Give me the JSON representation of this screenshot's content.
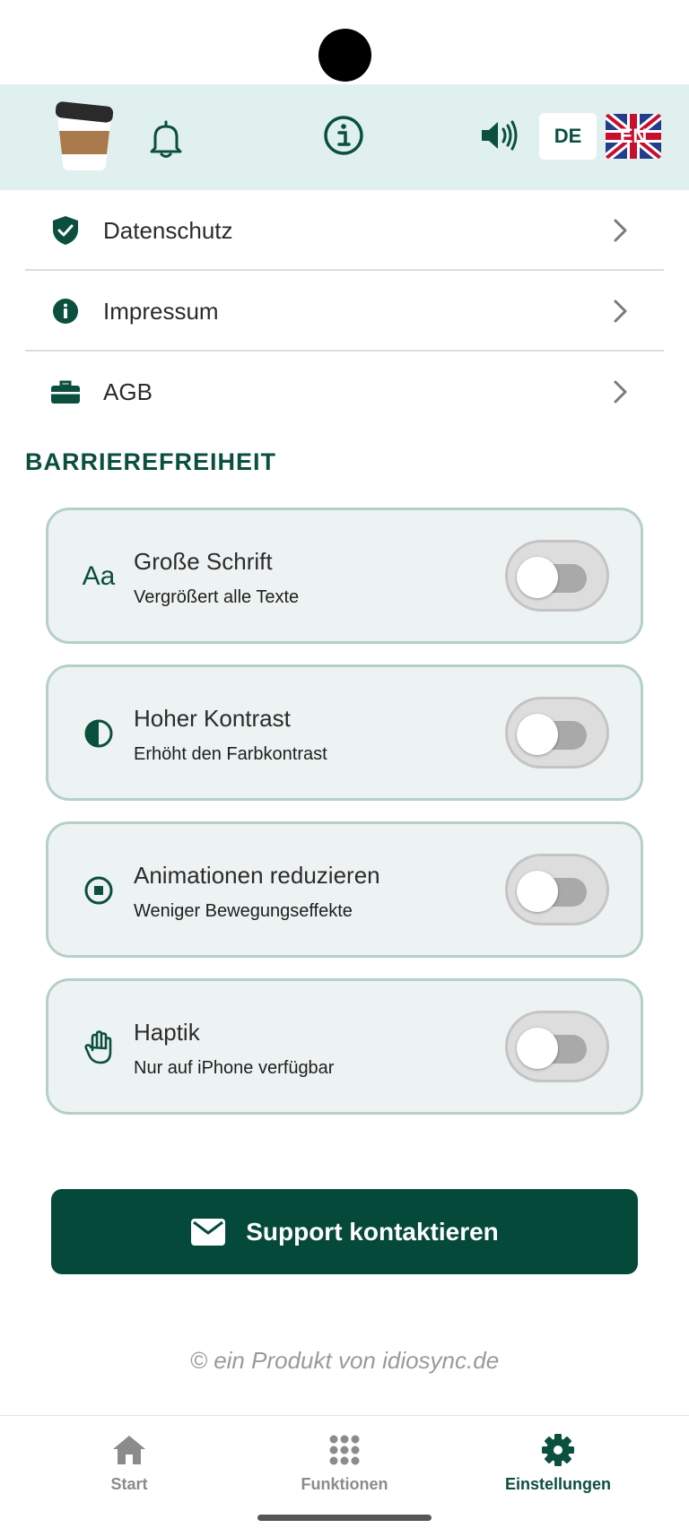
{
  "header": {
    "lang_de": "DE",
    "lang_en": "EN",
    "icons": [
      "coffee-cup-icon",
      "bell-icon",
      "info-icon",
      "speaker-icon",
      "uk-flag-icon"
    ]
  },
  "menu": {
    "items": [
      {
        "label": "Datenschutz",
        "icon": "shield-check-icon"
      },
      {
        "label": "Impressum",
        "icon": "info-icon"
      },
      {
        "label": "AGB",
        "icon": "briefcase-icon"
      }
    ]
  },
  "accessibility": {
    "title": "BARRIEREFREIHEIT",
    "cards": [
      {
        "icon_text": "Aa",
        "title": "Große Schrift",
        "subtitle": "Vergrößert alle Texte",
        "enabled": false
      },
      {
        "title": "Hoher Kontrast",
        "subtitle": "Erhöht den Farbkontrast",
        "enabled": false
      },
      {
        "title": "Animationen reduzieren",
        "subtitle": "Weniger Bewegungseffekte",
        "enabled": false
      },
      {
        "title": "Haptik",
        "subtitle": "Nur auf iPhone verfügbar",
        "enabled": false
      }
    ]
  },
  "support": {
    "label": "Support kontaktieren"
  },
  "footer": {
    "copyright": "© ein Produkt von idiosync.de"
  },
  "nav": {
    "items": [
      {
        "label": "Start",
        "active": false
      },
      {
        "label": "Funktionen",
        "active": false
      },
      {
        "label": "Einstellungen",
        "active": true
      }
    ]
  },
  "colors": {
    "brand": "#05493b",
    "header_bg": "#e0f0ef",
    "card_bg": "#edf3f2",
    "card_border": "#b5cfc9",
    "inactive": "#8b8b8b"
  }
}
